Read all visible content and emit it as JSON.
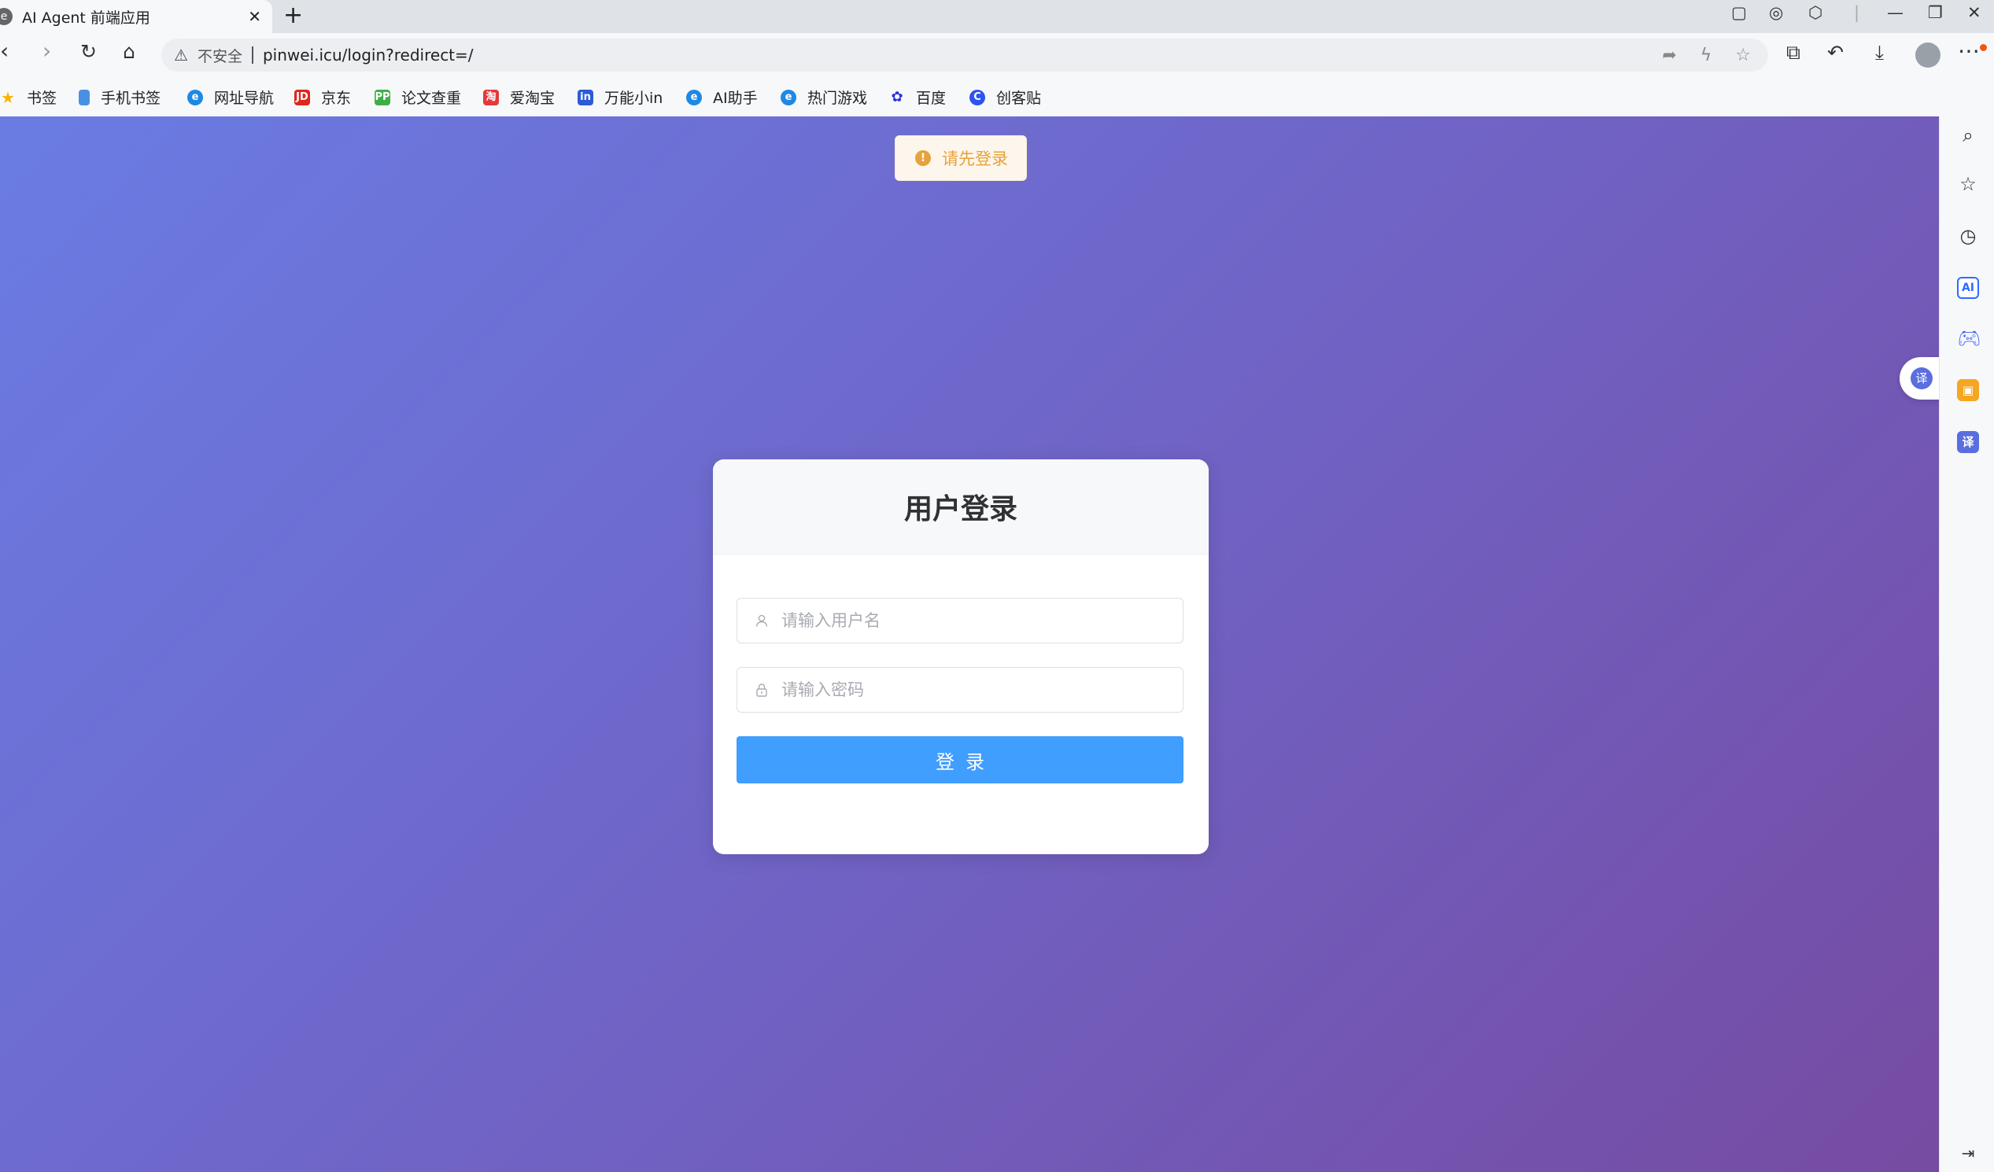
{
  "browser": {
    "tab_title": "AI Agent 前端应用",
    "tab_close": "✕",
    "new_tab": "+",
    "security_label": "不安全",
    "url": "pinwei.icu/login?redirect=/"
  },
  "bookmarks": [
    {
      "label": "书签",
      "icon": "star-icon",
      "color": "#f6b400"
    },
    {
      "label": "手机书签",
      "icon": "phone-bookmark-icon",
      "color": "#4a90e2"
    },
    {
      "label": "网址导航",
      "icon": "browser-logo-icon",
      "color": "#1e88e5"
    },
    {
      "label": "京东",
      "icon": "jd-icon",
      "color": "#e1251b"
    },
    {
      "label": "论文查重",
      "icon": "pp-icon",
      "color": "#3fae49"
    },
    {
      "label": "爱淘宝",
      "icon": "taobao-icon",
      "color": "#e4393c"
    },
    {
      "label": "万能小in",
      "icon": "xiaoin-icon",
      "color": "#2d5bd8"
    },
    {
      "label": "AI助手",
      "icon": "browser-logo-icon",
      "color": "#1e88e5"
    },
    {
      "label": "热门游戏",
      "icon": "browser-logo-icon",
      "color": "#1e88e5"
    },
    {
      "label": "百度",
      "icon": "baidu-paw-icon",
      "color": "#2932e1"
    },
    {
      "label": "创客贴",
      "icon": "chuangkit-icon",
      "color": "#2f54eb"
    }
  ],
  "toast": {
    "message": "请先登录",
    "color": "#e6a23c"
  },
  "login": {
    "title": "用户登录",
    "username_placeholder": "请输入用户名",
    "password_placeholder": "请输入密码",
    "submit_label": "登录",
    "button_color": "#409eff"
  },
  "background": {
    "gradient_start": "#6a7ce3",
    "gradient_end": "#764ba2"
  },
  "side_panel": {
    "ai_label": "AI",
    "translate_label": "译"
  }
}
